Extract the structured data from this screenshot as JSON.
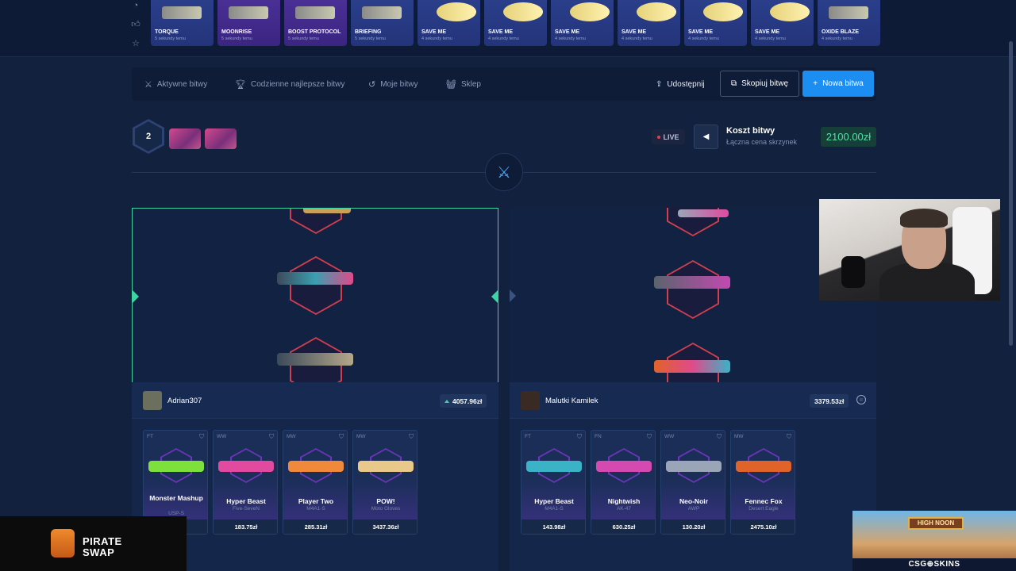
{
  "drops": [
    {
      "name": "TORQUE",
      "time": "5 sekundy temu",
      "style": "blue"
    },
    {
      "name": "MOONRISE",
      "time": "5 sekundy temu",
      "style": "purple"
    },
    {
      "name": "BOOST PROTOCOL",
      "time": "5 sekundy temu",
      "style": "purple"
    },
    {
      "name": "BRIEFING",
      "time": "5 sekundy temu",
      "style": "blue"
    },
    {
      "name": "SAVE ME",
      "time": "4 sekundy temu",
      "style": "blue"
    },
    {
      "name": "SAVE ME",
      "time": "4 sekundy temu",
      "style": "blue"
    },
    {
      "name": "SAVE ME",
      "time": "4 sekundy temu",
      "style": "blue"
    },
    {
      "name": "SAVE ME",
      "time": "4 sekundy temu",
      "style": "blue"
    },
    {
      "name": "SAVE ME",
      "time": "4 sekundy temu",
      "style": "blue"
    },
    {
      "name": "SAVE ME",
      "time": "4 sekundy temu",
      "style": "blue"
    },
    {
      "name": "OXIDE BLAZE",
      "time": "4 sekundy temu",
      "style": "blue"
    }
  ],
  "nav": {
    "active_battles": "Aktywne bitwy",
    "daily_best": "Codzienne najlepsze bitwy",
    "my_battles": "Moje bitwy",
    "shop": "Sklep",
    "share": "Udostępnij",
    "copy": "Skopiuj bitwę",
    "new": "Nowa bitwa"
  },
  "battle": {
    "rounds": "2",
    "live": "LIVE",
    "cost_title": "Koszt bitwy",
    "cost_sub": "Łączna cena skrzynek",
    "cost_value": "2100.00zł"
  },
  "players": [
    {
      "name": "Adrian307",
      "value": "4057.96zł",
      "items": [
        {
          "wear": "FT",
          "name": "Monster Mashup",
          "type": "USP-S",
          "price": "",
          "gun": "#7ee03a"
        },
        {
          "wear": "WW",
          "name": "Hyper Beast",
          "type": "Five-SeveN",
          "price": "183.75zł",
          "gun": "#e24aa0"
        },
        {
          "wear": "MW",
          "name": "Player Two",
          "type": "M4A1-S",
          "price": "285.31zł",
          "gun": "#f08a3a"
        },
        {
          "wear": "MW",
          "name": "POW!",
          "type": "Moto Gloves",
          "price": "3437.36zł",
          "gun": "#e8c98a"
        }
      ]
    },
    {
      "name": "Malutki Kamilek",
      "value": "3379.53zł",
      "items": [
        {
          "wear": "FT",
          "name": "Hyper Beast",
          "type": "M4A1-S",
          "price": "143.98zł",
          "gun": "#3ab3c6"
        },
        {
          "wear": "FN",
          "name": "Nightwish",
          "type": "AK-47",
          "price": "630.25zł",
          "gun": "#d44ab0"
        },
        {
          "wear": "WW",
          "name": "Neo-Noir",
          "type": "AWP",
          "price": "130.20zł",
          "gun": "#9aa6b8"
        },
        {
          "wear": "MW",
          "name": "Fennec Fox",
          "type": "Desert Eagle",
          "price": "2475.10zł",
          "gun": "#e0632a"
        }
      ]
    }
  ],
  "overlays": {
    "pirate_line1": "PIRATE",
    "pirate_line2": "SWAP",
    "high_noon": "HIGH NOON",
    "csg_brand": "CSG⊕SKINS"
  }
}
